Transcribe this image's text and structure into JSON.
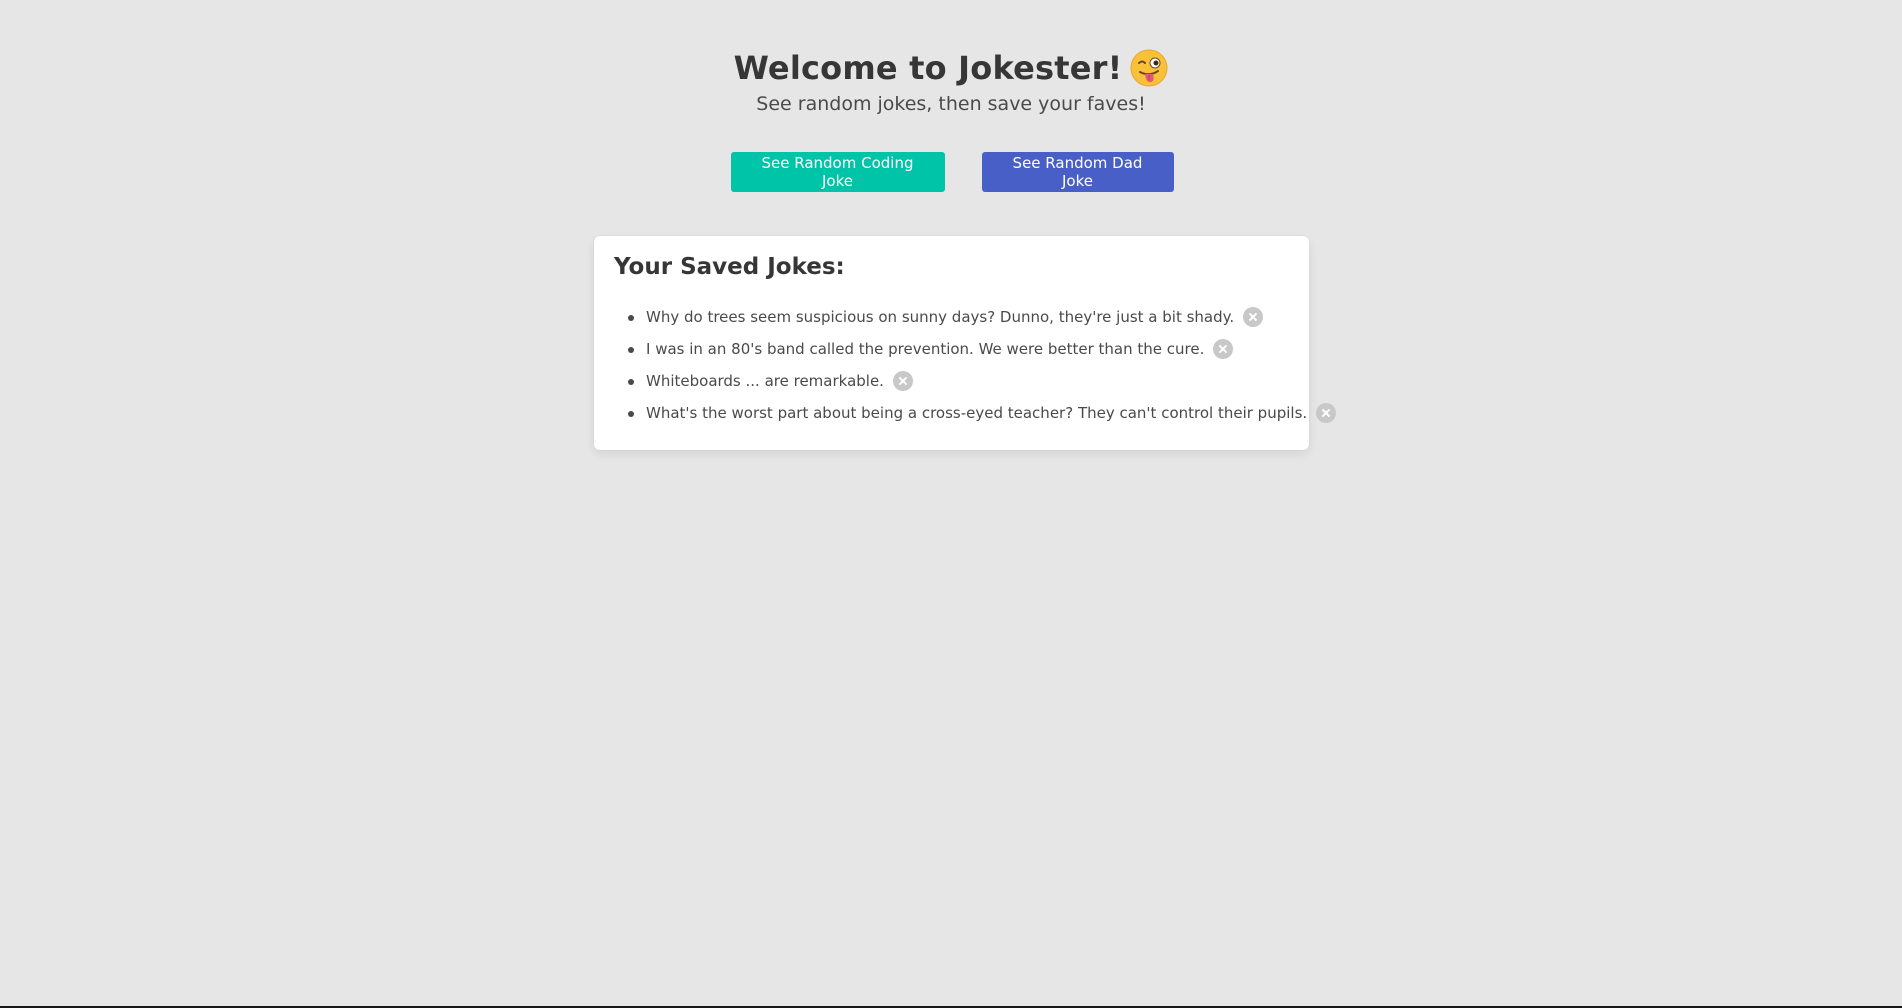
{
  "header": {
    "title": "Welcome to Jokester!",
    "title_icon": "winking-face-with-tongue-icon",
    "subtitle": "See random jokes, then save your faves!"
  },
  "actions": {
    "coding_button_label": "See Random Coding Joke",
    "dad_button_label": "See Random Dad Joke"
  },
  "saved": {
    "title": "Your Saved Jokes:",
    "delete_icon": "close-circle-icon",
    "jokes": [
      "Why do trees seem suspicious on sunny days? Dunno, they're just a bit shady.",
      "I was in an 80's band called the prevention. We were better than the cure.",
      "Whiteboards ... are remarkable.",
      "What's the worst part about being a cross-eyed teacher? They can't control their pupils."
    ]
  },
  "colors": {
    "background": "#e6e6e6",
    "coding_button": "#00c4a7",
    "dad_button": "#485fc7",
    "text": "#363636",
    "delete_icon": "#c8c8c8"
  }
}
